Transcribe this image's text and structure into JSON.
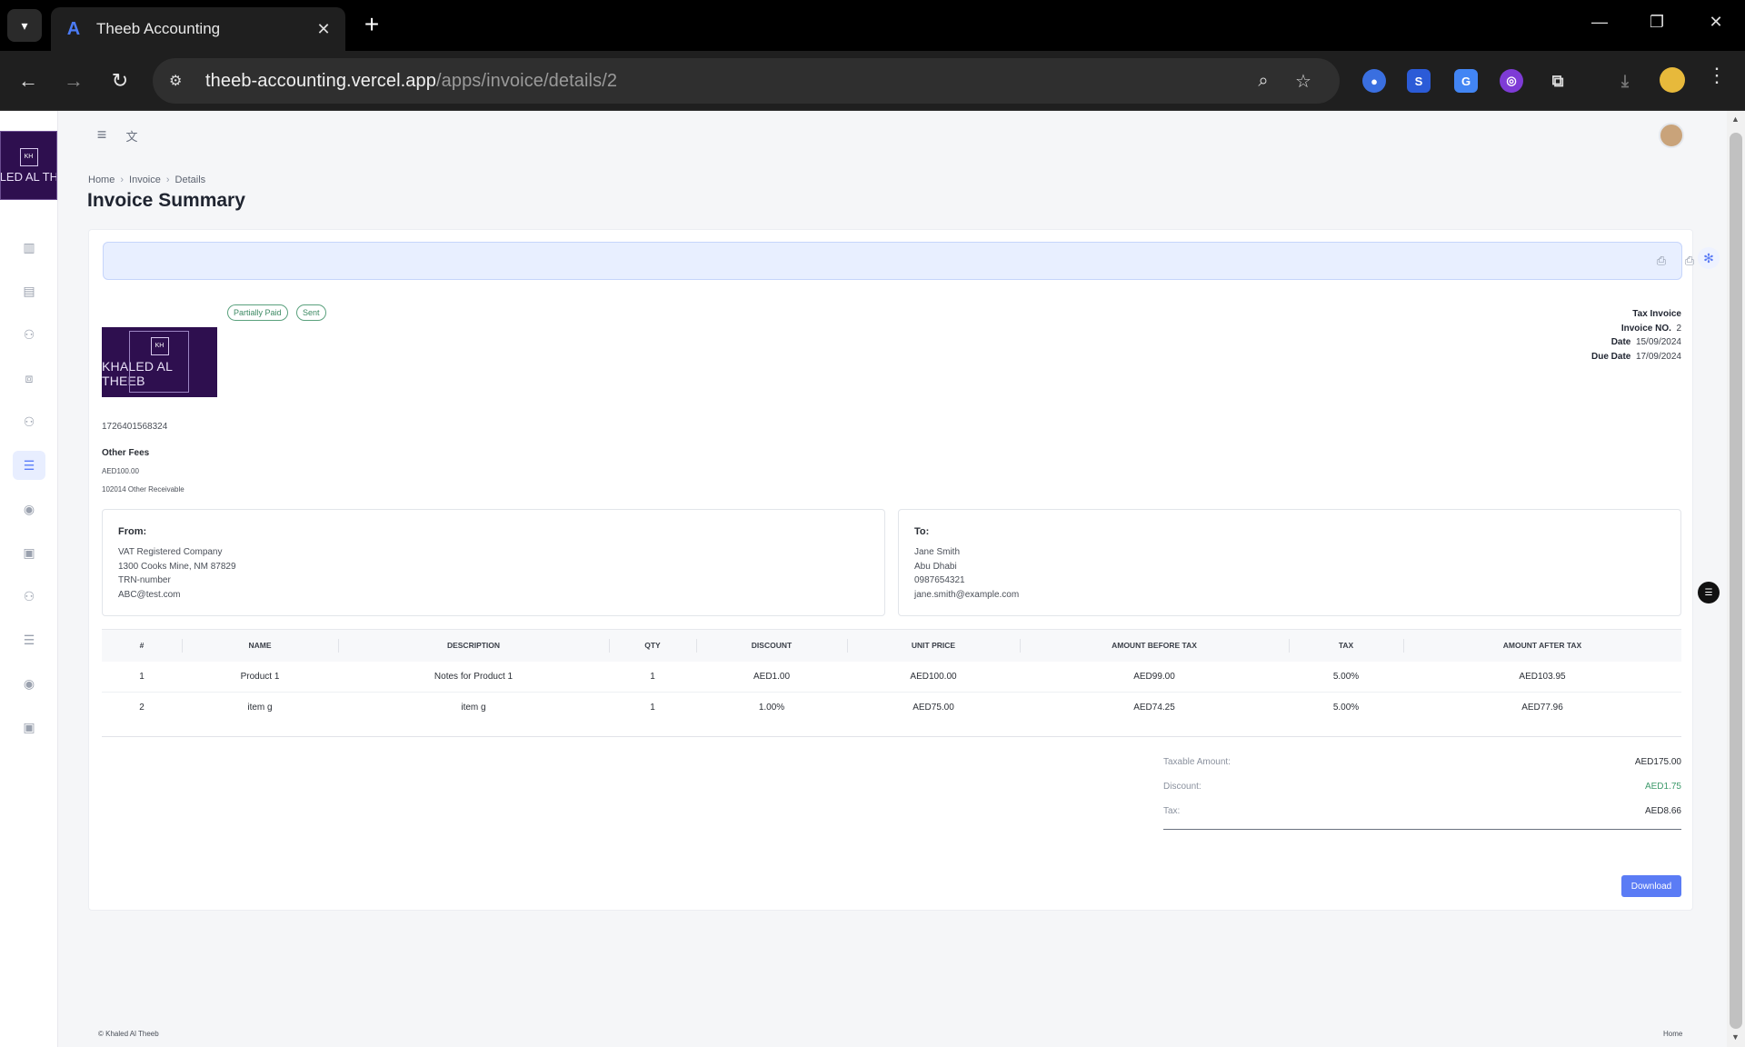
{
  "browser": {
    "tab_title": "Theeb Accounting",
    "url_host": "theeb-accounting.vercel.app",
    "url_path": "/apps/invoice/details/2"
  },
  "sidebar": {
    "logo_text": "KHALED AL THEEB",
    "items": [
      {
        "icon": "chart-icon"
      },
      {
        "icon": "document-icon"
      },
      {
        "icon": "users-icon"
      },
      {
        "icon": "products-icon"
      },
      {
        "icon": "customers-icon"
      },
      {
        "icon": "invoice-icon",
        "active": true
      },
      {
        "icon": "coins-icon"
      },
      {
        "icon": "clipboard-icon"
      },
      {
        "icon": "suppliers-icon"
      },
      {
        "icon": "bills-icon"
      },
      {
        "icon": "payments-icon"
      },
      {
        "icon": "reports-icon"
      }
    ]
  },
  "breadcrumb": [
    "Home",
    "Invoice",
    "Details"
  ],
  "page_title": "Invoice Summary",
  "invoice": {
    "badges": [
      "Partially Paid",
      "Sent"
    ],
    "logo_text": "KHALED AL THEEB",
    "meta": {
      "type_label": "Tax Invoice",
      "number_label": "Invoice NO.",
      "number": "2",
      "date_label": "Date",
      "date": "15/09/2024",
      "due_label": "Due Date",
      "due": "17/09/2024"
    },
    "ref_id": "1726401568324",
    "other_fees_label": "Other Fees",
    "other_fees_amount": "AED100.00",
    "other_fees_account": "102014 Other Receivable",
    "from": {
      "title": "From:",
      "lines": [
        "VAT Registered Company",
        "1300 Cooks Mine, NM 87829",
        "TRN-number",
        "ABC@test.com"
      ]
    },
    "to": {
      "title": "To:",
      "lines": [
        "Jane Smith",
        "Abu Dhabi",
        "0987654321",
        "jane.smith@example.com"
      ]
    },
    "columns": [
      "#",
      "NAME",
      "DESCRIPTION",
      "QTY",
      "DISCOUNT",
      "UNIT PRICE",
      "AMOUNT BEFORE TAX",
      "TAX",
      "AMOUNT AFTER TAX"
    ],
    "rows": [
      [
        "1",
        "Product 1",
        "Notes for Product 1",
        "1",
        "AED1.00",
        "AED100.00",
        "AED99.00",
        "5.00%",
        "AED103.95"
      ],
      [
        "2",
        "item g",
        "item g",
        "1",
        "1.00%",
        "AED75.00",
        "AED74.25",
        "5.00%",
        "AED77.96"
      ]
    ],
    "totals": {
      "taxable_label": "Taxable Amount:",
      "taxable": "AED175.00",
      "discount_label": "Discount:",
      "discount": "AED1.75",
      "tax_label": "Tax:",
      "tax": "AED8.66"
    },
    "download_label": "Download"
  },
  "footer": {
    "left": "© Khaled Al Theeb",
    "right": "Home"
  },
  "colors": {
    "accent": "#5b7cf5",
    "status_green": "#3d8a63",
    "brand_purple": "#2e0f4f"
  }
}
